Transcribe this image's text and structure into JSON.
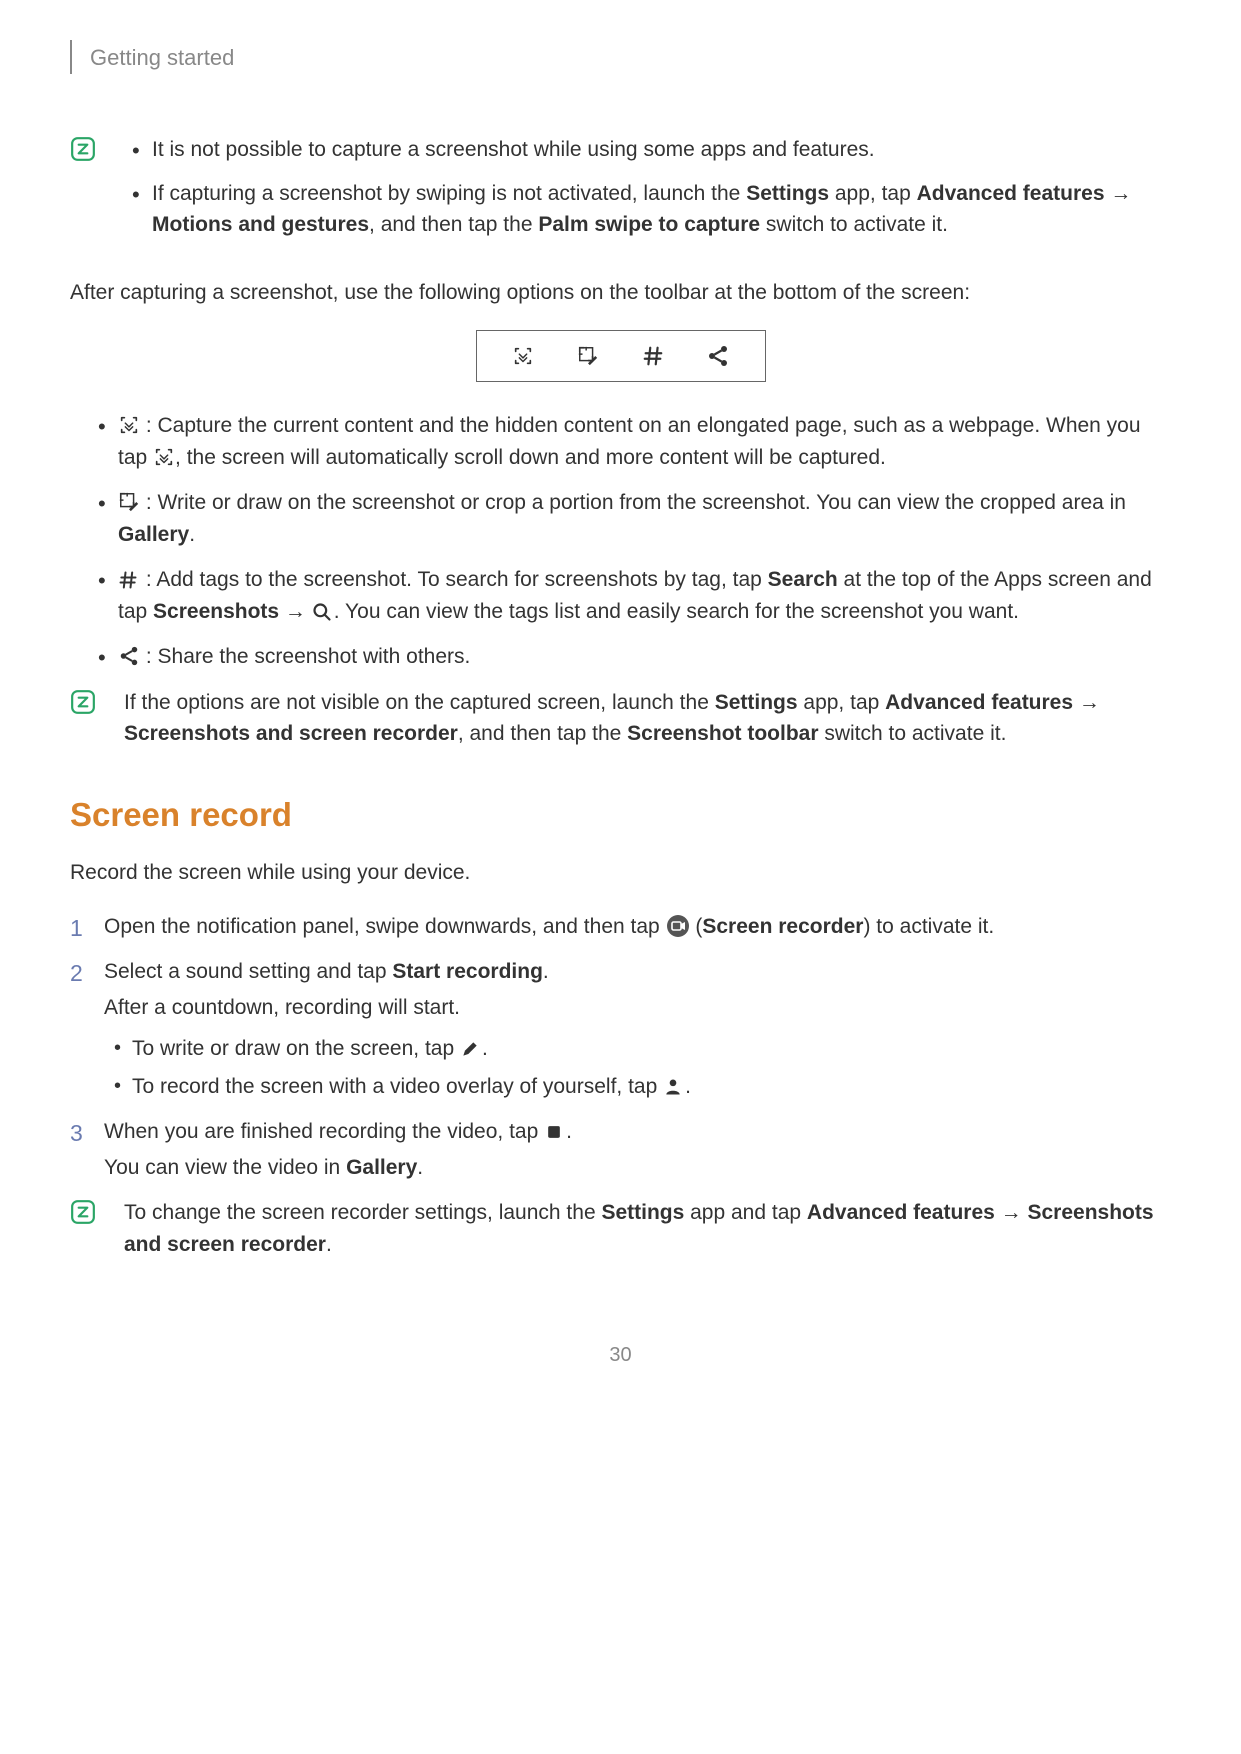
{
  "header": {
    "title": "Getting started"
  },
  "note1": {
    "b1": "It is not possible to capture a screenshot while using some apps and features.",
    "b2_pre": "If capturing a screenshot by swiping is not activated, launch the ",
    "b2_settings": "Settings",
    "b2_mid1": " app, tap ",
    "b2_af": "Advanced features",
    "b2_arrow": " → ",
    "b2_mg": "Motions and gestures",
    "b2_mid2": ", and then tap the ",
    "b2_ps": "Palm swipe to capture",
    "b2_end": " switch to activate it."
  },
  "para1": "After capturing a screenshot, use the following options on the toolbar at the bottom of the screen:",
  "iconlist": {
    "i1_a": " : Capture the current content and the hidden content on an elongated page, such as a webpage. When you tap ",
    "i1_b": ", the screen will automatically scroll down and more content will be captured.",
    "i2_a": " : Write or draw on the screenshot or crop a portion from the screenshot. You can view the cropped area in ",
    "i2_gallery": "Gallery",
    "i2_b": ".",
    "i3_a": " : Add tags to the screenshot. To search for screenshots by tag, tap ",
    "i3_search": "Search",
    "i3_b": " at the top of the Apps screen and tap ",
    "i3_sc": "Screenshots",
    "i3_arrow": " → ",
    "i3_c": ". You can view the tags list and easily search for the screenshot you want.",
    "i4": " : Share the screenshot with others."
  },
  "note2": {
    "a": "If the options are not visible on the captured screen, launch the ",
    "settings": "Settings",
    "b": " app, tap ",
    "af": "Advanced features",
    "arrow": " → ",
    "ssr": "Screenshots and screen recorder",
    "c": ", and then tap the ",
    "st": "Screenshot toolbar",
    "d": " switch to activate it."
  },
  "section": {
    "title": "Screen record",
    "intro": "Record the screen while using your device.",
    "step1_a": "Open the notification panel, swipe downwards, and then tap ",
    "step1_b": " (",
    "step1_sr": "Screen recorder",
    "step1_c": ") to activate it.",
    "step2_a": "Select a sound setting and tap ",
    "step2_start": "Start recording",
    "step2_b": ".",
    "step2_c": "After a countdown, recording will start.",
    "step2_sub1": "To write or draw on the screen, tap ",
    "step2_sub2": "To record the screen with a video overlay of yourself, tap ",
    "step3_a": "When you are finished recording the video, tap ",
    "step3_b": ".",
    "step3_c": "You can view the video in ",
    "step3_gallery": "Gallery",
    "step3_d": "."
  },
  "note3": {
    "a": "To change the screen recorder settings, launch the ",
    "settings": "Settings",
    "b": " app and tap ",
    "af": "Advanced features",
    "arrow": " → ",
    "ssr": "Screenshots and screen recorder",
    "c": "."
  },
  "page": "30"
}
